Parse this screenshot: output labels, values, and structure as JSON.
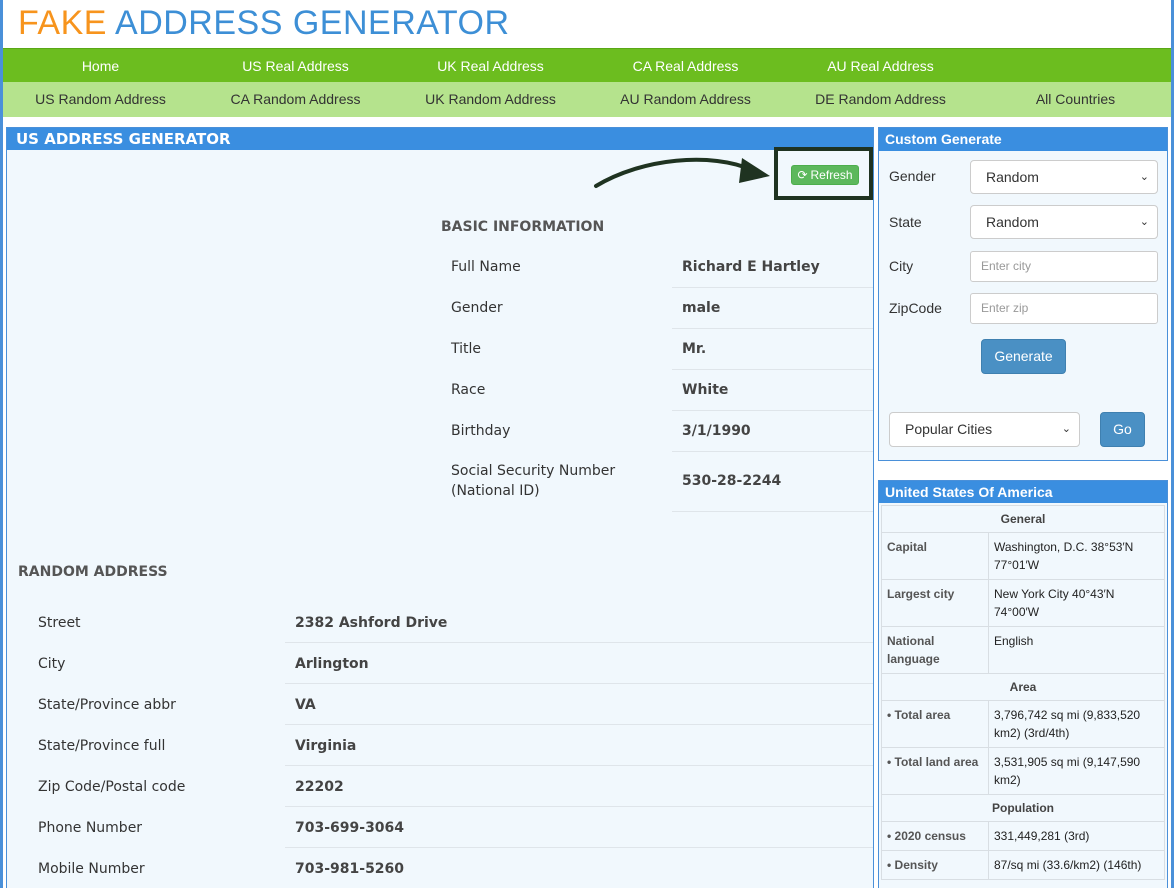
{
  "logo": {
    "word1": "FAKE",
    "word2": "ADDRESS GENERATOR"
  },
  "nav_primary": [
    "Home",
    "US Real Address",
    "UK Real Address",
    "CA Real Address",
    "AU Real Address"
  ],
  "nav_secondary": [
    "US Random Address",
    "CA Random Address",
    "UK Random Address",
    "AU Random Address",
    "DE Random Address",
    "All Countries"
  ],
  "main": {
    "title": "US ADDRESS GENERATOR",
    "refresh_label": "Refresh",
    "refresh_icon": "refresh-icon",
    "basic_title": "BASIC INFORMATION",
    "basic": [
      {
        "label": "Full Name",
        "value": "Richard E Hartley"
      },
      {
        "label": "Gender",
        "value": "male"
      },
      {
        "label": "Title",
        "value": "Mr."
      },
      {
        "label": "Race",
        "value": "White"
      },
      {
        "label": "Birthday",
        "value": "3/1/1990"
      },
      {
        "label": "Social Security Number",
        "label2": "(National ID)",
        "value": "530-28-2244"
      }
    ],
    "address_title": "RANDOM ADDRESS",
    "address": [
      {
        "label": "Street",
        "value": "2382 Ashford Drive"
      },
      {
        "label": "City",
        "value": "Arlington"
      },
      {
        "label": "State/Province abbr",
        "value": "VA"
      },
      {
        "label": "State/Province full",
        "value": "Virginia"
      },
      {
        "label": "Zip Code/Postal code",
        "value": "22202"
      },
      {
        "label": "Phone Number",
        "value": "703-699-3064"
      },
      {
        "label": "Mobile Number",
        "value": "703-981-5260"
      }
    ]
  },
  "custom": {
    "title": "Custom Generate",
    "gender_label": "Gender",
    "gender_value": "Random",
    "state_label": "State",
    "state_value": "Random",
    "city_label": "City",
    "city_placeholder": "Enter city",
    "zip_label": "ZipCode",
    "zip_placeholder": "Enter zip",
    "generate_label": "Generate",
    "popular_value": "Popular Cities",
    "go_label": "Go"
  },
  "usa": {
    "title": "United States Of America",
    "general": "General",
    "capital_k": "Capital",
    "capital_v": "Washington, D.C. 38°53′N 77°01′W",
    "largest_k": "Largest city",
    "largest_v": "New York City 40°43′N 74°00′W",
    "language_k": "National language",
    "language_v": "English",
    "area": "Area",
    "total_area_k": "• Total area",
    "total_area_v": "3,796,742 sq mi (9,833,520 km2) (3rd/4th)",
    "land_area_k": "• Total land area",
    "land_area_v": "3,531,905 sq mi (9,147,590 km2)",
    "population": "Population",
    "census_k": "• 2020 census",
    "census_v": "331,449,281 (3rd)",
    "density_k": "• Density",
    "density_v": "87/sq mi (33.6/km2) (146th)"
  },
  "colors": {
    "accent_blue": "#3a8ee0",
    "nav_green": "#6cbd1f",
    "nav_light_green": "#b5e38d",
    "logo_orange": "#f7941d",
    "refresh_green": "#5cb85c"
  }
}
